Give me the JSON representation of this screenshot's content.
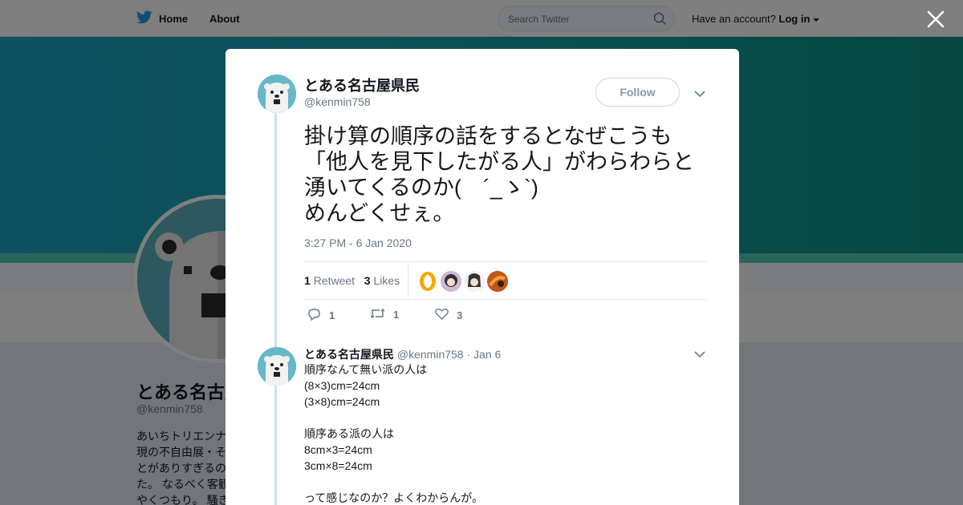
{
  "nav": {
    "home": "Home",
    "about": "About",
    "search_placeholder": "Search Twitter",
    "have_account": "Have an account?",
    "login": "Log in"
  },
  "profile": {
    "name": "とある名古屋県民",
    "handle": "@kenmin758",
    "bio_lines": [
      "あいちトリエンナ",
      "現の不自由展・そ",
      "とがありすぎるの",
      "た。 なるべく客観",
      "やくつもり。 騒き"
    ]
  },
  "tweet": {
    "author_name": "とある名古屋県民",
    "author_handle": "@kenmin758",
    "follow_label": "Follow",
    "text_lines": [
      "掛け算の順序の話をするとなぜこうも",
      "「他人を見下したがる人」がわらわらと",
      "湧いてくるのか(　´_ゝ`)",
      "めんどくせぇ。"
    ],
    "timestamp": "3:27 PM - 6 Jan 2020",
    "retweet_count": "1",
    "retweet_label": "Retweet",
    "like_count": "3",
    "like_label": "Likes",
    "actions": {
      "reply": "1",
      "retweet": "1",
      "like": "3"
    }
  },
  "reply": {
    "author_name": "とある名古屋県民",
    "author_handle": "@kenmin758",
    "date": "· Jan 6",
    "lines": [
      "順序なんて無い派の人は",
      "(8×3)cm=24cm",
      "(3×8)cm=24cm",
      "",
      "順序ある派の人は",
      "8cm×3=24cm",
      "3cm×8=24cm",
      "",
      "って感じなのか？よくわからんが。"
    ]
  },
  "colors": {
    "twitter_blue": "#1da1f2",
    "banner_start": "#1ea4c4",
    "banner_end": "#0b8e82",
    "avatar_bg": "#67b7c6"
  },
  "icons": [
    "twitter-bird-icon",
    "search-icon",
    "close-icon",
    "chevron-down-icon",
    "reply-icon",
    "retweet-icon",
    "heart-icon"
  ]
}
